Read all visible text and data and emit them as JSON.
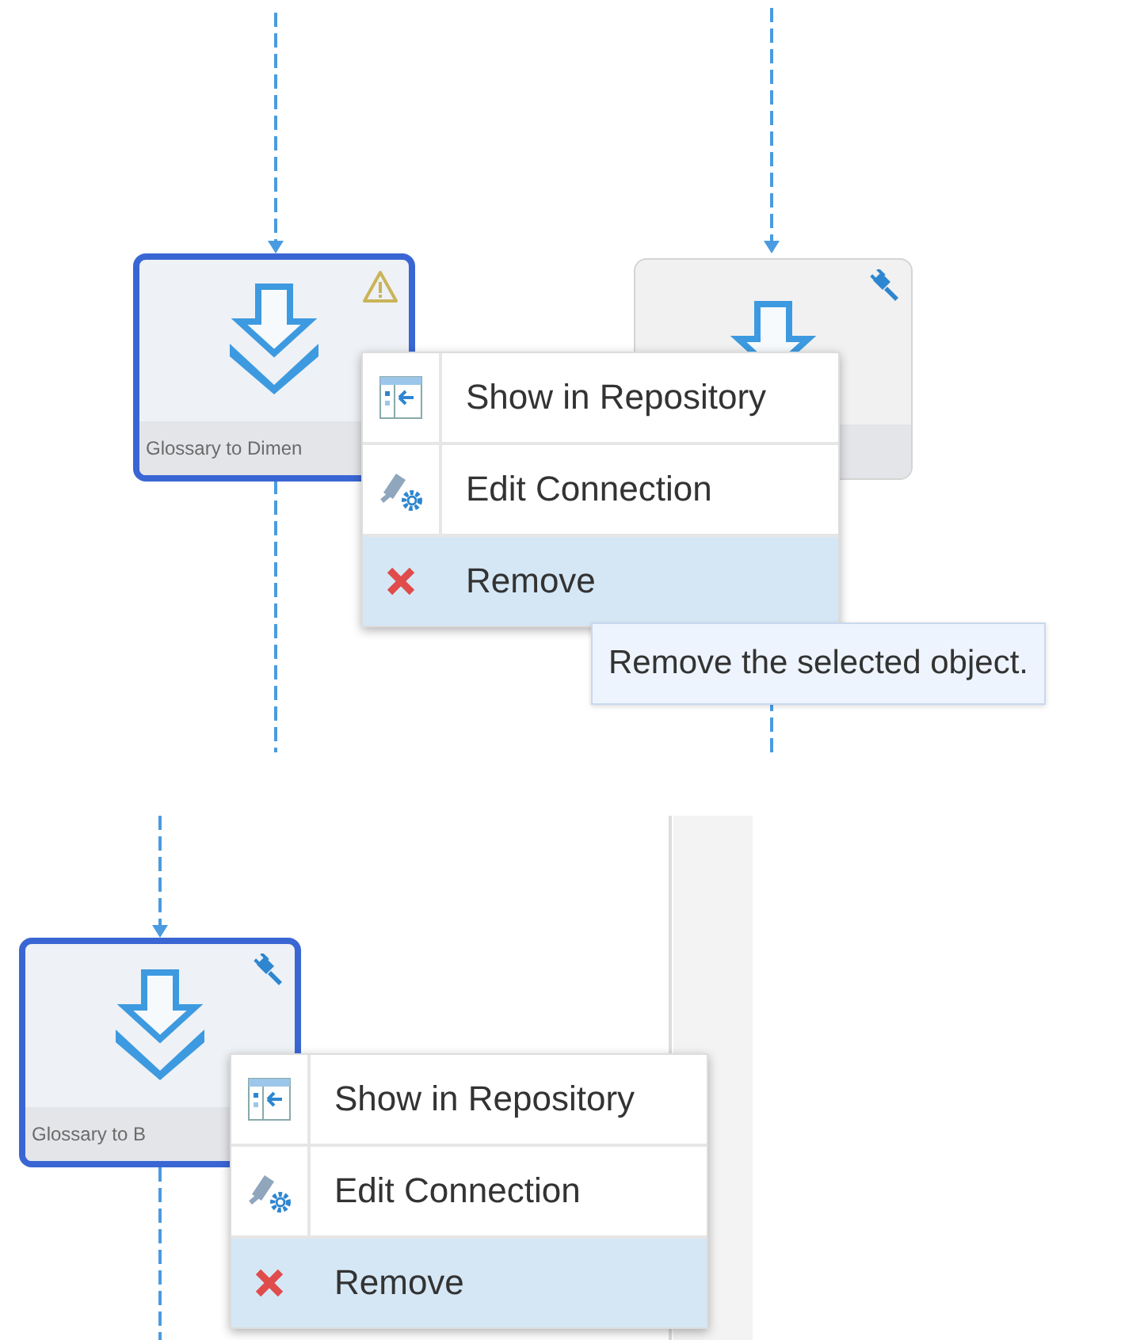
{
  "panels": [
    {
      "nodes": [
        {
          "label": "Glossary to Dimen",
          "selected": true,
          "kind": "warning"
        },
        {
          "selected": false,
          "kind": "connected"
        }
      ],
      "context_menu": {
        "items": [
          {
            "kind": "repository",
            "label": "Show in Repository",
            "selected": false
          },
          {
            "kind": "connection",
            "label": "Edit Connection",
            "selected": false
          },
          {
            "kind": "remove",
            "label": "Remove",
            "selected": true
          }
        ]
      },
      "tooltip": "Remove the selected object."
    },
    {
      "nodes": [
        {
          "label": "Glossary to B",
          "selected": true,
          "kind": "connected"
        }
      ],
      "context_menu": {
        "items": [
          {
            "kind": "repository",
            "label": "Show in Repository",
            "selected": false
          },
          {
            "kind": "connection",
            "label": "Edit Connection",
            "selected": false
          },
          {
            "kind": "remove",
            "label": "Remove",
            "selected": true
          }
        ]
      }
    }
  ]
}
